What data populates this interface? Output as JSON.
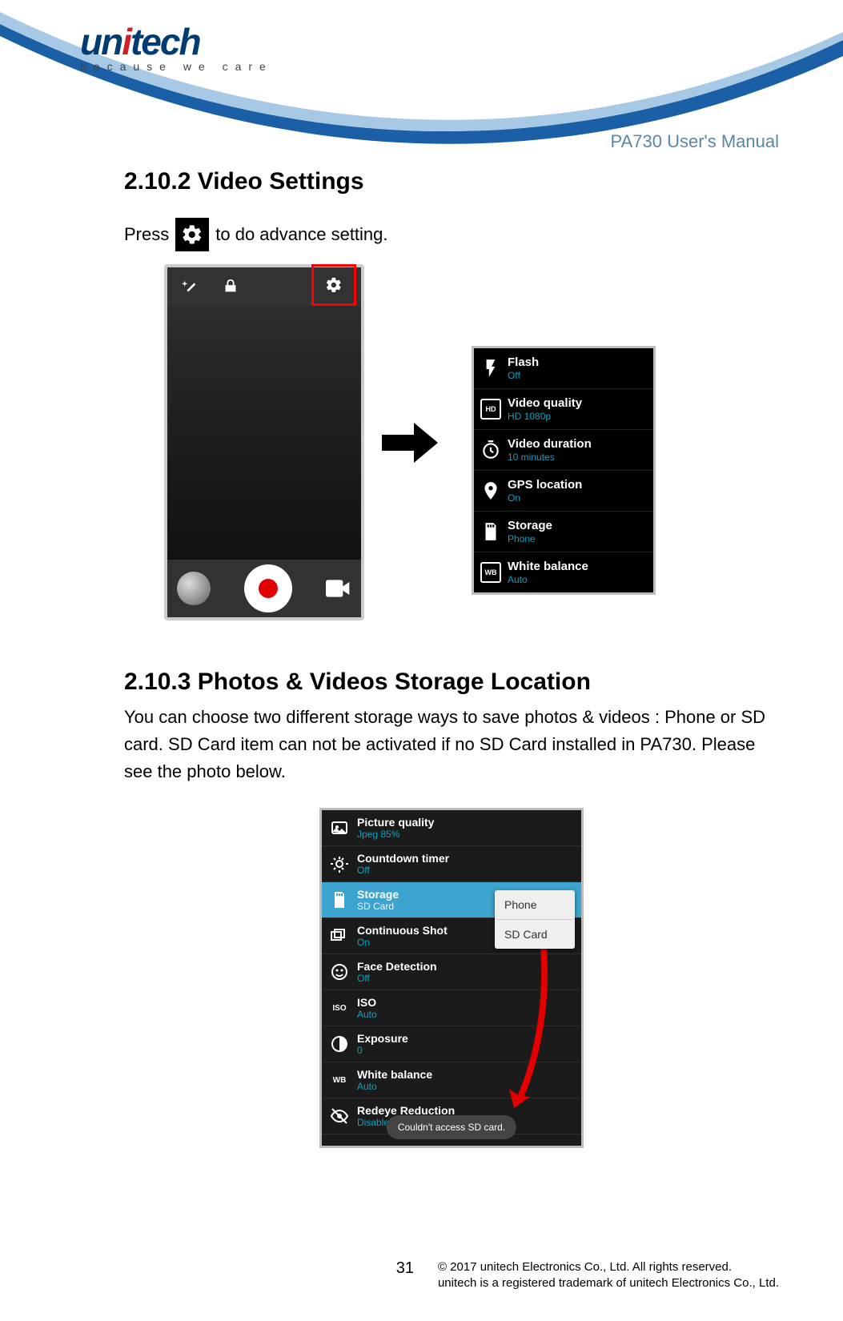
{
  "brand": {
    "name_pre": "un",
    "name_dot": "i",
    "name_post": "tech",
    "tagline": "because we care"
  },
  "doc_title": "PA730 User's Manual",
  "s1": {
    "heading": "2.10.2 Video Settings",
    "press_pre": "Press",
    "press_post": "to do advance setting."
  },
  "video_settings": [
    {
      "label": "Flash",
      "value": "Off"
    },
    {
      "label": "Video quality",
      "value": "HD 1080p"
    },
    {
      "label": "Video duration",
      "value": "10 minutes"
    },
    {
      "label": "GPS location",
      "value": "On"
    },
    {
      "label": "Storage",
      "value": "Phone"
    },
    {
      "label": "White balance",
      "value": "Auto"
    }
  ],
  "s2": {
    "heading": "2.10.3 Photos & Videos Storage Location",
    "body": "You can choose two different storage ways to save photos & videos : Phone or SD card. SD Card item can not be activated if no SD Card installed in PA730. Please see the photo below."
  },
  "cam_settings": [
    {
      "label": "Picture quality",
      "value": "Jpeg 85%"
    },
    {
      "label": "Countdown timer",
      "value": "Off"
    },
    {
      "label": "Storage",
      "value": "SD Card",
      "selected": true
    },
    {
      "label": "Continuous Shot",
      "value": "On"
    },
    {
      "label": "Face Detection",
      "value": "Off"
    },
    {
      "label": "ISO",
      "value": "Auto"
    },
    {
      "label": "Exposure",
      "value": "0"
    },
    {
      "label": "White balance",
      "value": "Auto"
    },
    {
      "label": "Redeye Reduction",
      "value": "Disable"
    }
  ],
  "storage_popup": {
    "opt1": "Phone",
    "opt2": "SD Card"
  },
  "toast": "Couldn't access SD card.",
  "footer": {
    "page": "31",
    "line1": "© 2017 unitech Electronics Co., Ltd. All rights reserved.",
    "line2": "unitech is a registered trademark of unitech Electronics Co., Ltd."
  }
}
